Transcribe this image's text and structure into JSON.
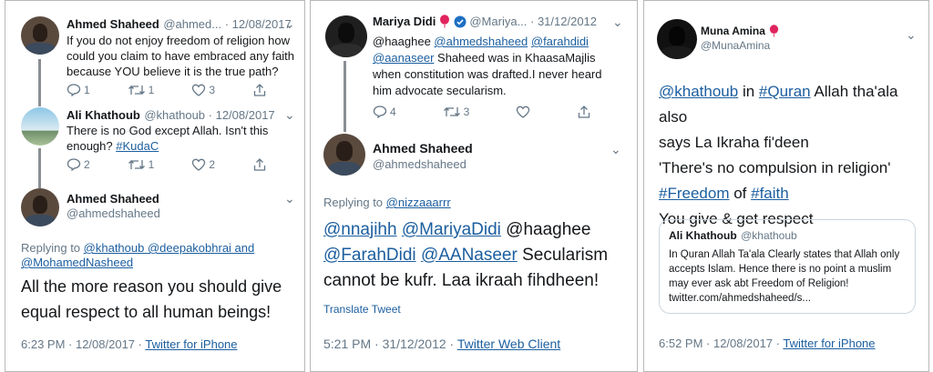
{
  "panel1": {
    "tweet1": {
      "name": "Ahmed Shaheed",
      "meta": "@ahmed... · 12/08/2017",
      "lines": [
        "If you do not enjoy freedom of religion how",
        "could you claim to have embraced any faith",
        "because YOU believe it is the true path?"
      ],
      "replies": "1",
      "retweets": "1",
      "likes": "3"
    },
    "tweet2": {
      "name": "Ali Khathoub",
      "meta": "@khathoub · 12/08/2017",
      "line1": "There is no God except Allah. Isn't this",
      "line2_text": "enough? ",
      "hashtag": "#KudaC",
      "replies": "2",
      "retweets": "1",
      "likes": "2"
    },
    "main": {
      "name": "Ahmed Shaheed",
      "handle": "@ahmedshaheed",
      "replying_prefix": "Replying to ",
      "replying_line1": "@khathoub @deepakobhrai and",
      "replying_line2": "@MohamedNasheed",
      "body_line1": "All the more reason you should give",
      "body_line2": "equal respect to all human beings!",
      "time": "6:23 PM · 12/08/2017 · ",
      "source": "Twitter for iPhone"
    }
  },
  "panel2": {
    "tweet1": {
      "name": "Mariya Didi",
      "meta": "@Mariya... · 31/12/2012",
      "mentions_a": "@haaghee ",
      "mentions_b": "@ahmedshaheed",
      "mentions_c": "@farahdidi",
      "mentions_d": "@aanaseer",
      "text_a": " Shaheed was in KhaasaMajlis",
      "text_b": "when constitution was drafted.I never heard",
      "text_c": "him advocate secularism.",
      "replies": "4",
      "retweets": "3"
    },
    "main": {
      "name": "Ahmed Shaheed",
      "handle": "@ahmedshaheed",
      "replying_prefix": "Replying to ",
      "replying_to": "@nizzaaarrr",
      "m1": "@nnajihh",
      "m2": "@MariyaDidi",
      "m3": " @haaghee",
      "m4": "@FarahDidi",
      "m5": "@AANaseer",
      "body_a": " Secularism",
      "body_b": "cannot be kufr. Laa ikraah fihdheen!",
      "translate": "Translate Tweet",
      "time": "5:21 PM · 31/12/2012 · ",
      "source": "Twitter Web Client"
    }
  },
  "panel3": {
    "main": {
      "name": "Muna Amina",
      "handle": "@MunaAmina",
      "l1_m": "@khathoub",
      "l1_in": " in ",
      "l1_h": "#Quran",
      "l1_t": " Allah tha'ala also",
      "l2": "says La Ikraha fi'deen",
      "l3": "'There's no compulsion in religion'",
      "l4_h1": "#Freedom",
      "l4_of": " of ",
      "l4_h2": "#faith",
      "l5": "You give & get respect",
      "time": "6:52 PM · 12/08/2017 · ",
      "source": "Twitter for iPhone"
    },
    "quote": {
      "name": "Ali Khathoub",
      "handle": "@khathoub",
      "lines": [
        "In Quran Allah Ta'ala Clearly states that Allah only",
        "accepts Islam.  Hence there is no point a muslim",
        "may ever ask abt Freedom of Religion!",
        "twitter.com/ahmedshaheed/s..."
      ]
    }
  },
  "colors": {
    "link": "#1b5e9f",
    "muted": "#657786",
    "verified": "#1d6fc2",
    "balloon": "#e0245e"
  }
}
